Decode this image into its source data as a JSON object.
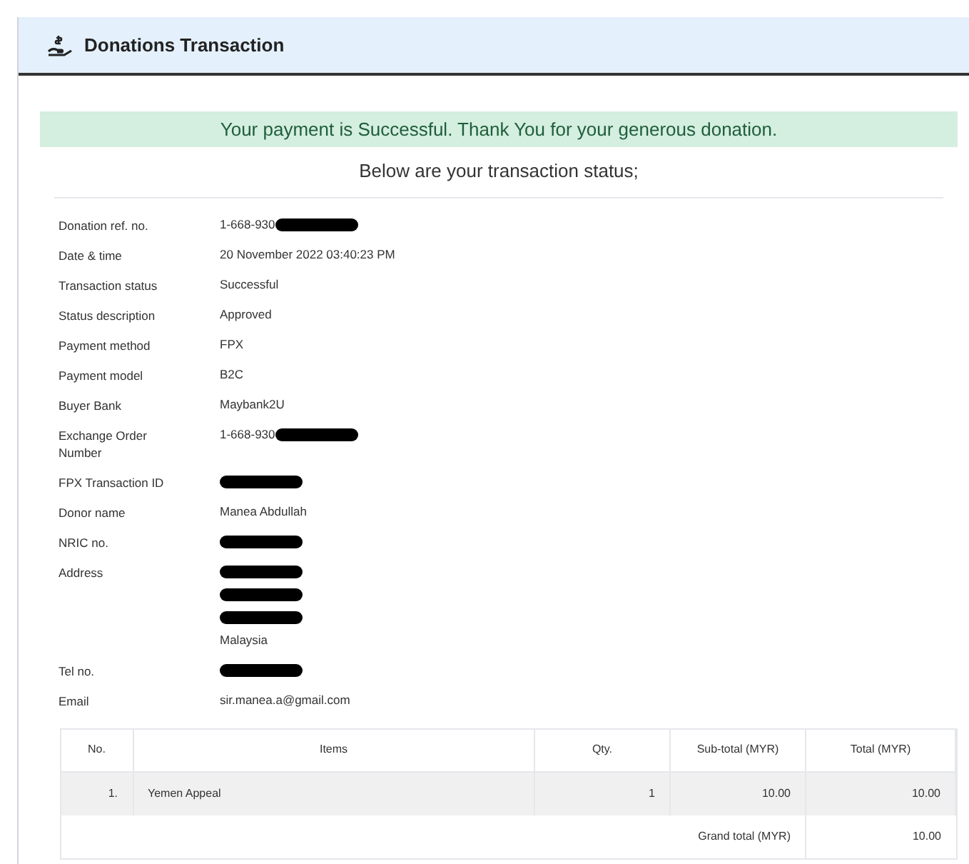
{
  "panel": {
    "title": "Donations Transaction"
  },
  "banner": "Your payment is Successful. Thank You for your generous donation.",
  "subtitle": "Below are your transaction status;",
  "details": [
    {
      "label": "Donation ref. no.",
      "lines": [
        {
          "text": "1-668-930",
          "redacted": true
        }
      ]
    },
    {
      "label": "Date & time",
      "lines": [
        {
          "text": "20 November 2022 03:40:23 PM",
          "redacted": false
        }
      ]
    },
    {
      "label": "Transaction status",
      "lines": [
        {
          "text": "Successful",
          "redacted": false
        }
      ]
    },
    {
      "label": "Status description",
      "lines": [
        {
          "text": "Approved",
          "redacted": false
        }
      ]
    },
    {
      "label": "Payment method",
      "lines": [
        {
          "text": "FPX",
          "redacted": false
        }
      ]
    },
    {
      "label": "Payment model",
      "lines": [
        {
          "text": "B2C",
          "redacted": false
        }
      ]
    },
    {
      "label": "Buyer Bank",
      "lines": [
        {
          "text": "Maybank2U",
          "redacted": false
        }
      ]
    },
    {
      "label": "Exchange Order Number",
      "lines": [
        {
          "text": "1-668-930",
          "redacted": true
        }
      ]
    },
    {
      "label": "FPX Transaction ID",
      "lines": [
        {
          "redacted": true
        }
      ]
    },
    {
      "label": "Donor name",
      "lines": [
        {
          "text": "Manea Abdullah",
          "redacted": false
        }
      ]
    },
    {
      "label": "NRIC no.",
      "lines": [
        {
          "redacted": true
        }
      ]
    },
    {
      "label": "Address",
      "lines": [
        {
          "redacted": true
        },
        {
          "redacted": true
        },
        {
          "redacted": true
        },
        {
          "text": "Malaysia",
          "redacted": false
        }
      ]
    },
    {
      "label": "Tel no.",
      "lines": [
        {
          "redacted": true
        }
      ]
    },
    {
      "label": "Email",
      "lines": [
        {
          "text": "sir.manea.a@gmail.com",
          "redacted": false
        }
      ]
    }
  ],
  "table": {
    "columns": [
      "No.",
      "Items",
      "Qty.",
      "Sub-total (MYR)",
      "Total (MYR)"
    ],
    "rows": [
      [
        "1.",
        "Yemen Appeal",
        "1",
        "10.00",
        "10.00"
      ]
    ],
    "footer": {
      "label": "Grand total (MYR)",
      "value": "10.00"
    }
  }
}
